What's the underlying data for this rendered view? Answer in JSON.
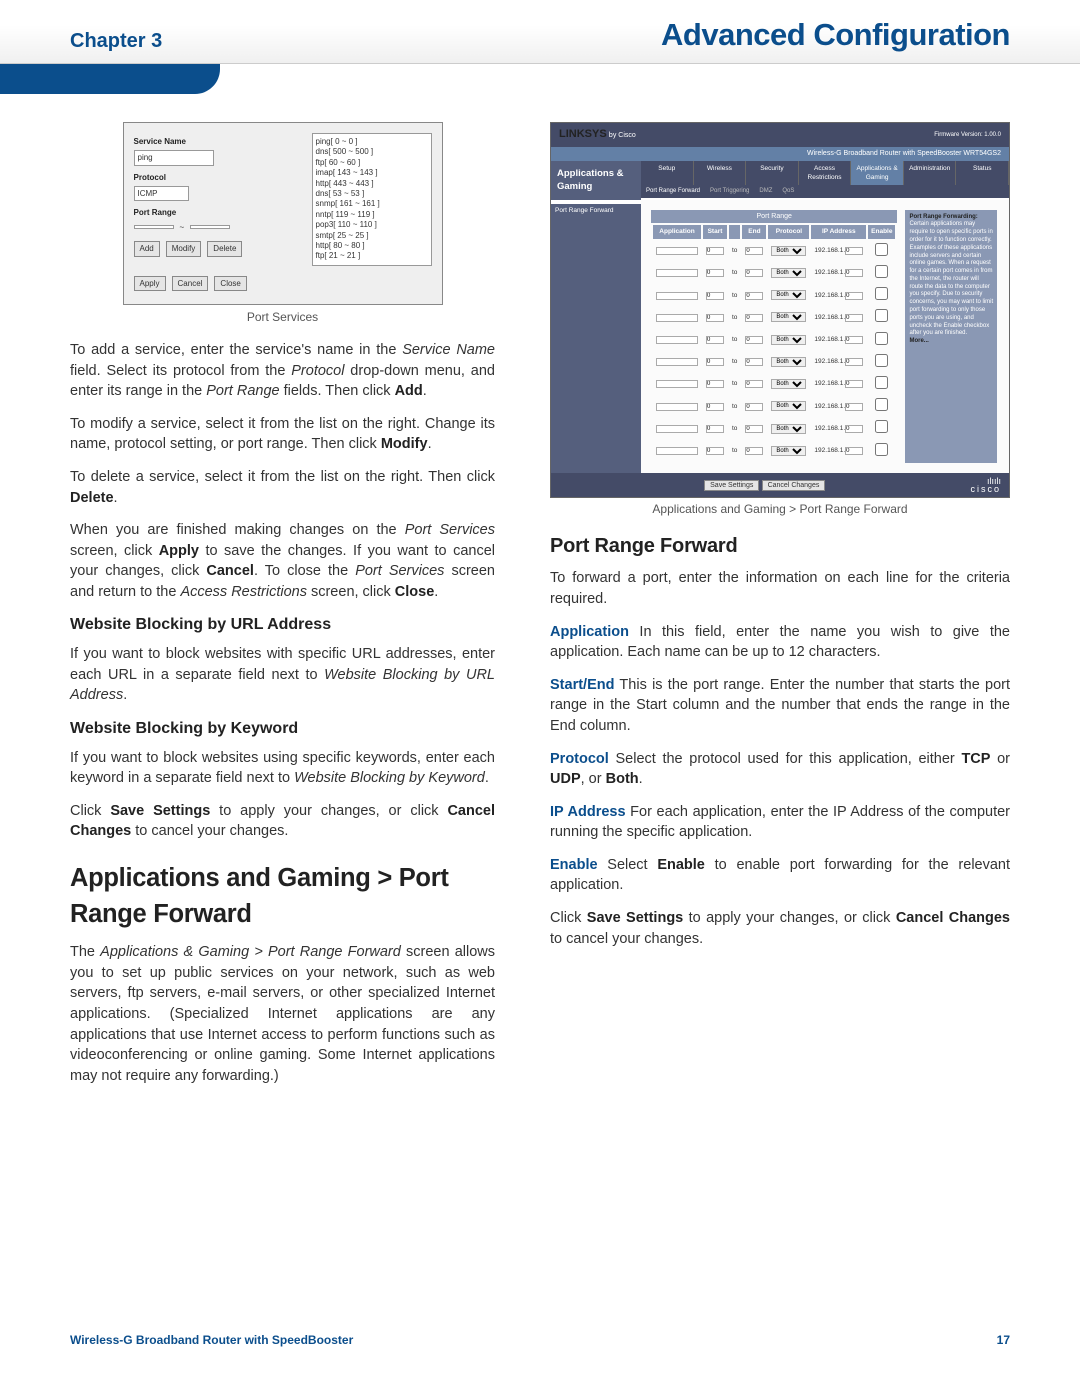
{
  "header": {
    "chapter": "Chapter 3",
    "title": "Advanced Configuration"
  },
  "figure1": {
    "service_name_label": "Service Name",
    "service_name_value": "ping",
    "protocol_label": "Protocol",
    "protocol_value": "ICMP",
    "port_range_label": "Port Range",
    "buttons": {
      "add": "Add",
      "modify": "Modify",
      "delete": "Delete",
      "apply": "Apply",
      "cancel": "Cancel",
      "close": "Close"
    },
    "list": [
      "ping[ 0 ~ 0 ]",
      "dns[ 500 ~ 500 ]",
      "ftp[ 60 ~ 60 ]",
      "imap[ 143 ~ 143 ]",
      "http[ 443 ~ 443 ]",
      "dns[ 53 ~ 53 ]",
      "snmp[ 161 ~ 161 ]",
      "nntp[ 119 ~ 119 ]",
      "pop3[ 110 ~ 110 ]",
      "smtp[ 25 ~ 25 ]",
      "http[ 80 ~ 80 ]",
      "ftp[ 21 ~ 21 ]"
    ],
    "caption": "Port Services"
  },
  "left": {
    "p1_a": "To add a service, enter the service's name in the ",
    "p1_b": "Service Name",
    "p1_c": " field. Select its protocol from the ",
    "p1_d": "Protocol",
    "p1_e": " drop-down menu, and enter its range in the ",
    "p1_f": "Port Range",
    "p1_g": " fields. Then click ",
    "p1_h": "Add",
    "p1_i": ".",
    "p2_a": "To modify a service, select it from the list on the right. Change its name, protocol setting, or port range. Then click ",
    "p2_b": "Modify",
    "p2_c": ".",
    "p3_a": "To delete a service, select it from the list on the right. Then click ",
    "p3_b": "Delete",
    "p3_c": ".",
    "p4_a": "When you are finished making changes on the ",
    "p4_b": "Port Services",
    "p4_c": " screen, click ",
    "p4_d": "Apply",
    "p4_e": " to save the changes. If you want to cancel your changes, click ",
    "p4_f": "Cancel",
    "p4_g": ". To close the ",
    "p4_h": "Port Services",
    "p4_i": " screen and return to the ",
    "p4_j": "Access Restrictions",
    "p4_k": " screen, click ",
    "p4_l": "Close",
    "p4_m": ".",
    "h4a": "Website Blocking by URL Address",
    "p5_a": "If you want to block websites with specific URL addresses, enter each URL in a separate field next to ",
    "p5_b": "Website Blocking by URL Address",
    "p5_c": ".",
    "h4b": "Website Blocking by Keyword",
    "p6_a": "If you want to block websites using specific keywords, enter each keyword in a separate field next to ",
    "p6_b": "Website Blocking by Keyword",
    "p6_c": ".",
    "p7_a": "Click ",
    "p7_b": "Save Settings",
    "p7_c": " to apply your changes, or click ",
    "p7_d": "Cancel Changes",
    "p7_e": " to cancel your changes.",
    "h2": "Applications and Gaming > Port Range Forward",
    "p8": "The Applications & Gaming > Port Range Forward screen allows you to set up public services on your network, such as web servers, ftp servers, e-mail servers, or other specialized Internet applications. (Specialized Internet applications are any applications that use Internet access to perform functions such as videoconferencing or online gaming. Some Internet applications may not require any forwarding.)",
    "p8_it": "Applications & Gaming > Port Range Forward"
  },
  "figure2": {
    "brand": "LINKSYS",
    "by": "by Cisco",
    "banner": "Wireless-G Broadband Router with SpeedBooster    WRT54GS2",
    "side": "Applications & Gaming",
    "side_sub": "Port Range Forward",
    "tabs": [
      "Setup",
      "Wireless",
      "Security",
      "Access Restrictions",
      "Applications & Gaming",
      "Administration",
      "Status"
    ],
    "subtabs": [
      "Port Range Forward",
      "Port Triggering",
      "DMZ",
      "QoS"
    ],
    "table_headers": [
      "Application",
      "Start",
      "End",
      "Protocol",
      "IP Address",
      "Enable"
    ],
    "table_title": "Port Range",
    "ip_prefix": "192.168.1.",
    "proto_opt": "Both",
    "help_title": "Port Range Forwarding:",
    "help_body": "Certain applications may require to open specific ports in order for it to function correctly. Examples of these applications include servers and certain online games. When a request for a certain port comes in from the Internet, the router will route the data to the computer you specify. Due to security concerns, you may want to limit port forwarding to only those ports you are using, and uncheck the Enable checkbox after you are finished.",
    "more": "More...",
    "save": "Save Settings",
    "cancel": "Cancel Changes",
    "cisco": "cisco",
    "caption": "Applications and Gaming > Port Range Forward"
  },
  "right": {
    "h3": "Port Range Forward",
    "intro": "To forward a port, enter the information on each line for the criteria required.",
    "d1_t": "Application",
    "d1": "  In this field, enter the name you wish to give the application. Each name can be up to 12 characters.",
    "d2_t": "Start/End",
    "d2": "  This is the port range. Enter the number that starts the port range in the Start column and the number that ends the range in the End column.",
    "d3_t": "Protocol",
    "d3_a": "  Select the protocol used for this application, either ",
    "d3_b": "TCP",
    "d3_c": " or ",
    "d3_d": "UDP",
    "d3_e": ", or ",
    "d3_f": "Both",
    "d3_g": ".",
    "d4_t": "IP Address",
    "d4": "  For each application, enter the IP Address of the computer running the specific application.",
    "d5_t": "Enable",
    "d5_a": "  Select ",
    "d5_b": "Enable",
    "d5_c": " to enable port forwarding for the relevant application.",
    "p_end_a": "Click ",
    "p_end_b": "Save Settings",
    "p_end_c": " to apply your changes, or click ",
    "p_end_d": "Cancel Changes",
    "p_end_e": " to cancel your changes."
  },
  "footer": {
    "left": "Wireless-G Broadband Router with SpeedBooster",
    "right": "17"
  }
}
